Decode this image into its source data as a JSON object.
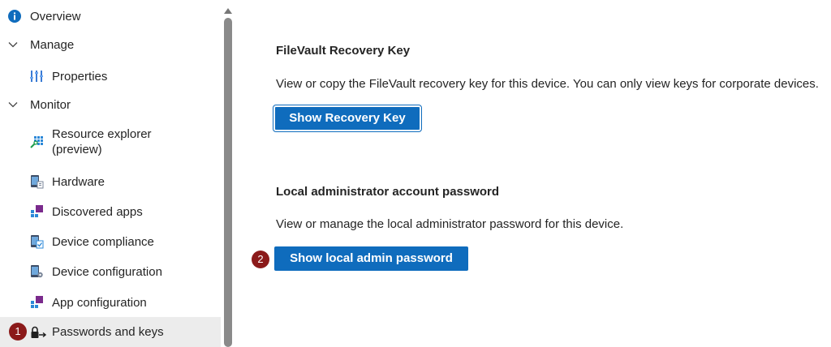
{
  "sidebar": {
    "items": [
      {
        "label": "Overview",
        "icon": "info-icon"
      },
      {
        "label": "Manage",
        "icon": "chevron-down-icon"
      },
      {
        "label": "Properties",
        "icon": "properties-icon"
      },
      {
        "label": "Monitor",
        "icon": "chevron-down-icon"
      },
      {
        "label": "Resource explorer",
        "label2": "(preview)",
        "icon": "resource-explorer-icon"
      },
      {
        "label": "Hardware",
        "icon": "hardware-icon"
      },
      {
        "label": "Discovered apps",
        "icon": "apps-icon"
      },
      {
        "label": "Device compliance",
        "icon": "device-compliance-icon"
      },
      {
        "label": "Device configuration",
        "icon": "device-configuration-icon"
      },
      {
        "label": "App configuration",
        "icon": "app-configuration-icon"
      },
      {
        "label": "Passwords and keys",
        "icon": "lock-key-icon",
        "selected": true
      }
    ]
  },
  "main": {
    "filevault": {
      "title": "FileVault Recovery Key",
      "description": "View or copy the FileVault recovery key for this device. You can only view keys for corporate devices.",
      "button_label": "Show Recovery Key"
    },
    "local_admin": {
      "title": "Local administrator account password",
      "description": "View or manage the local administrator password for this device.",
      "button_label": "Show local admin password"
    }
  },
  "callouts": {
    "step1": "1",
    "step2": "2"
  },
  "colors": {
    "accent": "#0f6cbd",
    "callout": "#8b1a1a",
    "selected_bg": "#ececec"
  }
}
